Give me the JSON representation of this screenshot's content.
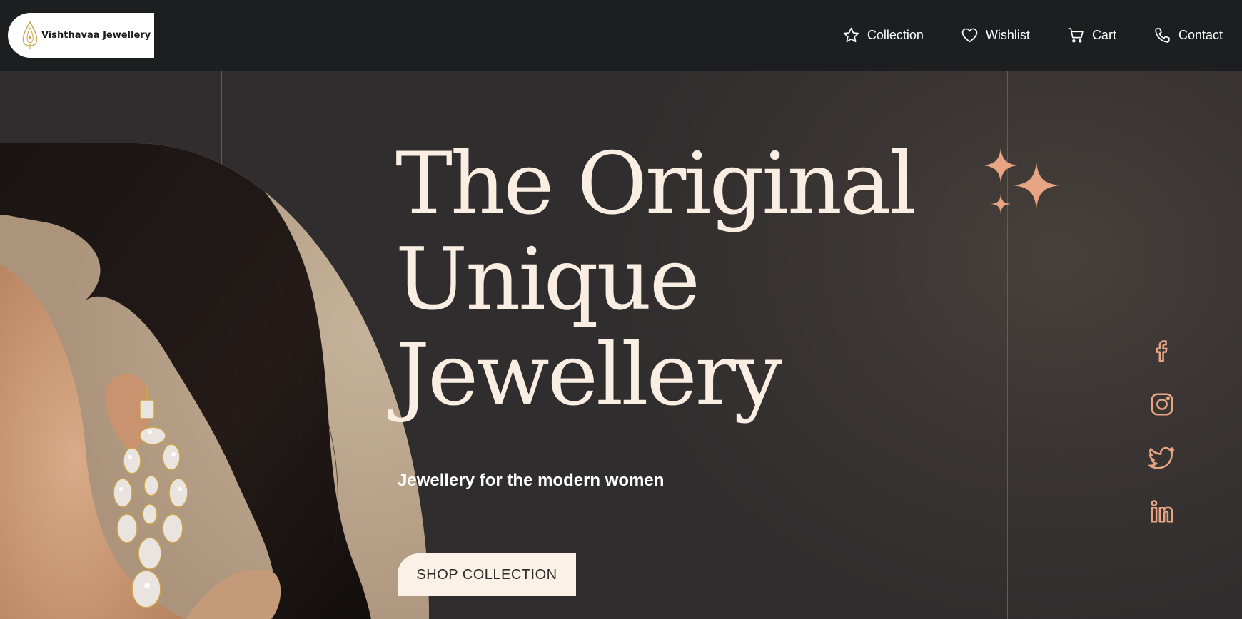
{
  "brand": {
    "name": "Vishthavaa Jewellery",
    "logo_icon": "leaf-drop-icon",
    "accent_color": "#e8a583"
  },
  "nav": {
    "items": [
      {
        "label": "Collection",
        "icon": "star-icon"
      },
      {
        "label": "Wishlist",
        "icon": "heart-icon"
      },
      {
        "label": "Cart",
        "icon": "cart-icon"
      },
      {
        "label": "Contact",
        "icon": "phone-icon"
      }
    ]
  },
  "hero": {
    "headline_lines": [
      "The Original",
      "Unique",
      "Jewellery"
    ],
    "subtitle": "Jewellery for the modern women",
    "cta_label": "SHOP COLLECTION",
    "image": "woman-with-crystal-earring",
    "decoration": "sparkles-icon"
  },
  "social": {
    "items": [
      {
        "name": "facebook-icon"
      },
      {
        "name": "instagram-icon"
      },
      {
        "name": "twitter-icon"
      },
      {
        "name": "linkedin-icon"
      }
    ]
  },
  "colors": {
    "header_bg": "#1d1e20",
    "hero_bg": "#2f2c2d",
    "headline": "#faeee3",
    "button_bg": "#fcf1e7"
  }
}
